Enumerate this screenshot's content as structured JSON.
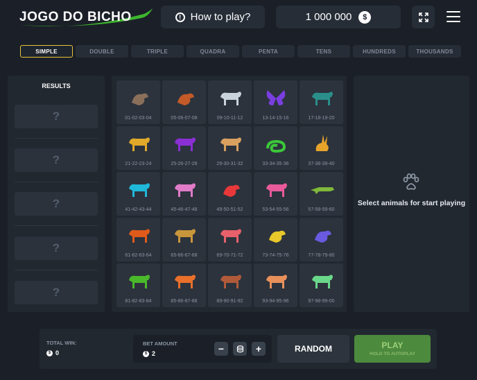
{
  "header": {
    "logo_text": "JOGO DO BICHO",
    "how_to_play": "How to play?",
    "balance": "1 000 000",
    "currency_symbol": "$"
  },
  "tabs": [
    {
      "label": "SIMPLE",
      "active": true
    },
    {
      "label": "DOUBLE",
      "active": false
    },
    {
      "label": "TRIPLE",
      "active": false
    },
    {
      "label": "QUADRA",
      "active": false
    },
    {
      "label": "PENTA",
      "active": false
    },
    {
      "label": "TENS",
      "active": false
    },
    {
      "label": "HUNDREDS",
      "active": false
    },
    {
      "label": "THOUSANDS",
      "active": false
    }
  ],
  "results": {
    "title": "RESULTS",
    "slots": [
      "?",
      "?",
      "?",
      "?",
      "?"
    ]
  },
  "animals": [
    {
      "name": "ostrich",
      "numbers": "01-02-03-04",
      "color": "#8a6f5a"
    },
    {
      "name": "eagle",
      "numbers": "05-06-07-08",
      "color": "#c45a28"
    },
    {
      "name": "donkey",
      "numbers": "09-10-11-12",
      "color": "#c8d3dc"
    },
    {
      "name": "butterfly",
      "numbers": "13-14-15-16",
      "color": "#7a3fe0"
    },
    {
      "name": "dog",
      "numbers": "17-18-19-20",
      "color": "#2a8f8a"
    },
    {
      "name": "goat",
      "numbers": "21-22-23-24",
      "color": "#e0a92a"
    },
    {
      "name": "ram",
      "numbers": "25-26-27-28",
      "color": "#8a2fd4"
    },
    {
      "name": "camel",
      "numbers": "29-30-31-32",
      "color": "#d9a060"
    },
    {
      "name": "snake",
      "numbers": "33-34-35-36",
      "color": "#3cc83a"
    },
    {
      "name": "rabbit",
      "numbers": "37-38-39-40",
      "color": "#e8a42a"
    },
    {
      "name": "horse",
      "numbers": "41-42-43-44",
      "color": "#1fb8d8"
    },
    {
      "name": "elephant",
      "numbers": "45-46-47-48",
      "color": "#e07bc8"
    },
    {
      "name": "rooster",
      "numbers": "49-50-51-52",
      "color": "#e8383a"
    },
    {
      "name": "cat",
      "numbers": "53-54-55-56",
      "color": "#e85a9a"
    },
    {
      "name": "alligator",
      "numbers": "57-58-59-60",
      "color": "#7fb83a"
    },
    {
      "name": "lion",
      "numbers": "61-62-63-64",
      "color": "#e05a1a"
    },
    {
      "name": "monkey",
      "numbers": "65-66-67-68",
      "color": "#c8963a"
    },
    {
      "name": "pig",
      "numbers": "69-70-71-72",
      "color": "#e8606a"
    },
    {
      "name": "peacock",
      "numbers": "73-74-75-76",
      "color": "#e8c82a"
    },
    {
      "name": "turkey",
      "numbers": "77-78-79-80",
      "color": "#6a5ae0"
    },
    {
      "name": "bull",
      "numbers": "81-82-83-84",
      "color": "#4ab82a"
    },
    {
      "name": "tiger",
      "numbers": "85-86-87-88",
      "color": "#e8702a"
    },
    {
      "name": "bear",
      "numbers": "89-90-91-92",
      "color": "#b05a3a"
    },
    {
      "name": "deer",
      "numbers": "93-94-95-96",
      "color": "#e8905a"
    },
    {
      "name": "cow",
      "numbers": "97-98-99-00",
      "color": "#6ad88a"
    }
  ],
  "selection": {
    "message": "Select animals for start playing"
  },
  "bottom": {
    "total_win_label": "TOTAL WIN:",
    "total_win_value": "0",
    "bet_amount_label": "BET AMOUNT",
    "bet_amount_value": "2",
    "minus": "−",
    "plus": "+",
    "random": "RANDOM",
    "play": "PLAY",
    "play_sub": "HOLD TO AUTOPLAY"
  }
}
